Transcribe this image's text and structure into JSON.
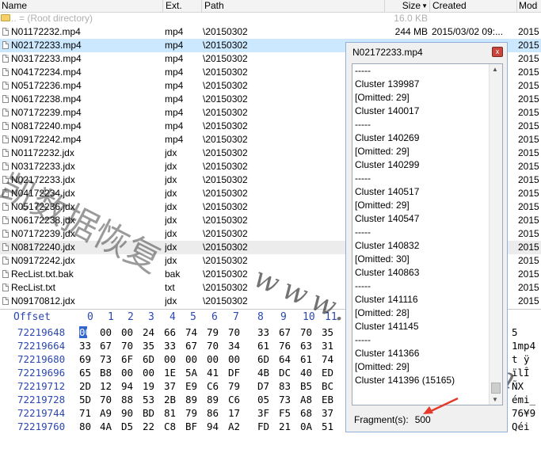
{
  "columns": {
    "name": "Name",
    "ext": "Ext.",
    "path": "Path",
    "size": "Size",
    "created": "Created",
    "modified": "Mod"
  },
  "root_row": {
    "name": "..  =   (Root directory)",
    "size": "16.0 KB"
  },
  "files": [
    {
      "name": "N01172232.mp4",
      "ext": "mp4",
      "path": "\\20150302",
      "size": "244 MB",
      "created": "2015/03/02  09:...",
      "mod": "2015"
    },
    {
      "name": "N02172233.mp4",
      "ext": "mp4",
      "path": "\\20150302",
      "size": "",
      "created": "",
      "mod": "2015"
    },
    {
      "name": "N03172233.mp4",
      "ext": "mp4",
      "path": "\\20150302",
      "size": "",
      "created": "",
      "mod": "2015"
    },
    {
      "name": "N04172234.mp4",
      "ext": "mp4",
      "path": "\\20150302",
      "size": "",
      "created": "",
      "mod": "2015"
    },
    {
      "name": "N05172236.mp4",
      "ext": "mp4",
      "path": "\\20150302",
      "size": "",
      "created": "",
      "mod": "2015"
    },
    {
      "name": "N06172238.mp4",
      "ext": "mp4",
      "path": "\\20150302",
      "size": "",
      "created": "",
      "mod": "2015"
    },
    {
      "name": "N07172239.mp4",
      "ext": "mp4",
      "path": "\\20150302",
      "size": "",
      "created": "",
      "mod": "2015"
    },
    {
      "name": "N08172240.mp4",
      "ext": "mp4",
      "path": "\\20150302",
      "size": "",
      "created": "",
      "mod": "2015"
    },
    {
      "name": "N09172242.mp4",
      "ext": "mp4",
      "path": "\\20150302",
      "size": "",
      "created": "",
      "mod": "2015"
    },
    {
      "name": "N01172232.jdx",
      "ext": "jdx",
      "path": "\\20150302",
      "size": "",
      "created": "",
      "mod": "2015"
    },
    {
      "name": "N03172233.jdx",
      "ext": "jdx",
      "path": "\\20150302",
      "size": "",
      "created": "",
      "mod": "2015"
    },
    {
      "name": "N02172233.jdx",
      "ext": "jdx",
      "path": "\\20150302",
      "size": "",
      "created": "",
      "mod": "2015"
    },
    {
      "name": "N04172234.jdx",
      "ext": "jdx",
      "path": "\\20150302",
      "size": "",
      "created": "",
      "mod": "2015"
    },
    {
      "name": "N05172236.jdx",
      "ext": "jdx",
      "path": "\\20150302",
      "size": "",
      "created": "",
      "mod": "2015"
    },
    {
      "name": "N06172238.jdx",
      "ext": "jdx",
      "path": "\\20150302",
      "size": "",
      "created": "",
      "mod": "2015"
    },
    {
      "name": "N07172239.jdx",
      "ext": "jdx",
      "path": "\\20150302",
      "size": "",
      "created": "",
      "mod": "2015"
    },
    {
      "name": "N08172240.jdx",
      "ext": "jdx",
      "path": "\\20150302",
      "size": "",
      "created": "",
      "mod": "2015"
    },
    {
      "name": "N09172242.jdx",
      "ext": "jdx",
      "path": "\\20150302",
      "size": "",
      "created": "",
      "mod": "2015"
    },
    {
      "name": "RecList.txt.bak",
      "ext": "bak",
      "path": "\\20150302",
      "size": "",
      "created": "",
      "mod": "2015"
    },
    {
      "name": "RecList.txt",
      "ext": "txt",
      "path": "\\20150302",
      "size": "",
      "created": "",
      "mod": "2015"
    },
    {
      "name": "N09170812.jdx",
      "ext": "jdx",
      "path": "\\20150302",
      "size": "",
      "created": "",
      "mod": "2015"
    }
  ],
  "hex": {
    "offset_label": "Offset",
    "col_labels": [
      "0",
      "1",
      "2",
      "3",
      "4",
      "5",
      "6",
      "7",
      "8",
      "9",
      "10",
      "11"
    ],
    "rows": [
      {
        "off": "72219648",
        "bytes": [
          "00",
          "00",
          "00",
          "24",
          "66",
          "74",
          "79",
          "70",
          "33",
          "67",
          "70",
          "35"
        ],
        "ascii": "5"
      },
      {
        "off": "72219664",
        "bytes": [
          "33",
          "67",
          "70",
          "35",
          "33",
          "67",
          "70",
          "34",
          "61",
          "76",
          "63",
          "31"
        ],
        "ascii": "1mp4"
      },
      {
        "off": "72219680",
        "bytes": [
          "69",
          "73",
          "6F",
          "6D",
          "00",
          "00",
          "00",
          "00",
          "6D",
          "64",
          "61",
          "74"
        ],
        "ascii": "t  ÿ"
      },
      {
        "off": "72219696",
        "bytes": [
          "65",
          "B8",
          "00",
          "00",
          "1E",
          "5A",
          "41",
          "DF",
          "4B",
          "DC",
          "40",
          "ED"
        ],
        "ascii": "ïlÎ"
      },
      {
        "off": "72219712",
        "bytes": [
          "2D",
          "12",
          "94",
          "19",
          "37",
          "E9",
          "C6",
          "79",
          "D7",
          "83",
          "B5",
          "BC"
        ],
        "ascii": "ÑX"
      },
      {
        "off": "72219728",
        "bytes": [
          "5D",
          "70",
          "88",
          "53",
          "2B",
          "89",
          "89",
          "C6",
          "05",
          "73",
          "A8",
          "EB"
        ],
        "ascii": "émi_"
      },
      {
        "off": "72219744",
        "bytes": [
          "71",
          "A9",
          "90",
          "BD",
          "81",
          "79",
          "86",
          "17",
          "3F",
          "F5",
          "68",
          "37"
        ],
        "ascii": "76¥9"
      },
      {
        "off": "72219760",
        "bytes": [
          "80",
          "4A",
          "D5",
          "22",
          "C8",
          "BF",
          "94",
          "A2",
          "FD",
          "21",
          "0A",
          "51"
        ],
        "ascii": "Qéi"
      }
    ]
  },
  "dialog": {
    "title": "N02172233.mp4",
    "close_glyph": "x",
    "lines": [
      "-----",
      "Cluster 139987",
      "[Omitted: 29]",
      "Cluster 140017",
      "-----",
      "Cluster 140269",
      "[Omitted: 29]",
      "Cluster 140299",
      "-----",
      "Cluster 140517",
      "[Omitted: 29]",
      "Cluster 140547",
      "-----",
      "Cluster 140832",
      "[Omitted: 30]",
      "Cluster 140863",
      "-----",
      "Cluster 141116",
      "[Omitted: 28]",
      "Cluster 141145",
      "-----",
      "Cluster 141366",
      "[Omitted: 29]",
      "Cluster 141396 (15165)"
    ],
    "fragments_label": "Fragment(s):",
    "fragments_value": "500"
  },
  "watermark": {
    "chinese": "凯数据恢复",
    "url": "www.sysfix.cn"
  },
  "colors": {
    "selection": "#cce8ff",
    "hex_offset": "#2c48b0",
    "arrow": "#e53a2a"
  }
}
